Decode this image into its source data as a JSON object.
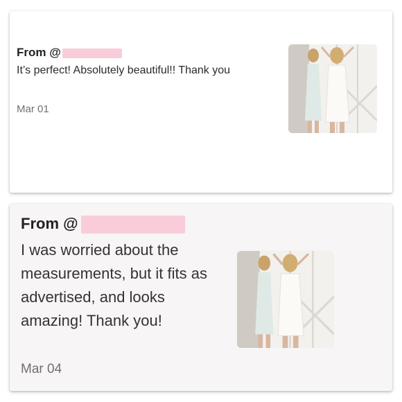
{
  "reviews": [
    {
      "from_prefix": "From @",
      "from_tail": "",
      "message": "It’s perfect! Absolutely beautiful!! Thank you",
      "date": "Mar 01"
    },
    {
      "from_prefix": "From @",
      "message": "I was worried about the measurements, but it fits as advertised, and looks amazing! Thank you!",
      "date": "Mar 04"
    }
  ],
  "colors": {
    "redaction": "#f8cdd9",
    "card_bg": "#ffffff"
  }
}
